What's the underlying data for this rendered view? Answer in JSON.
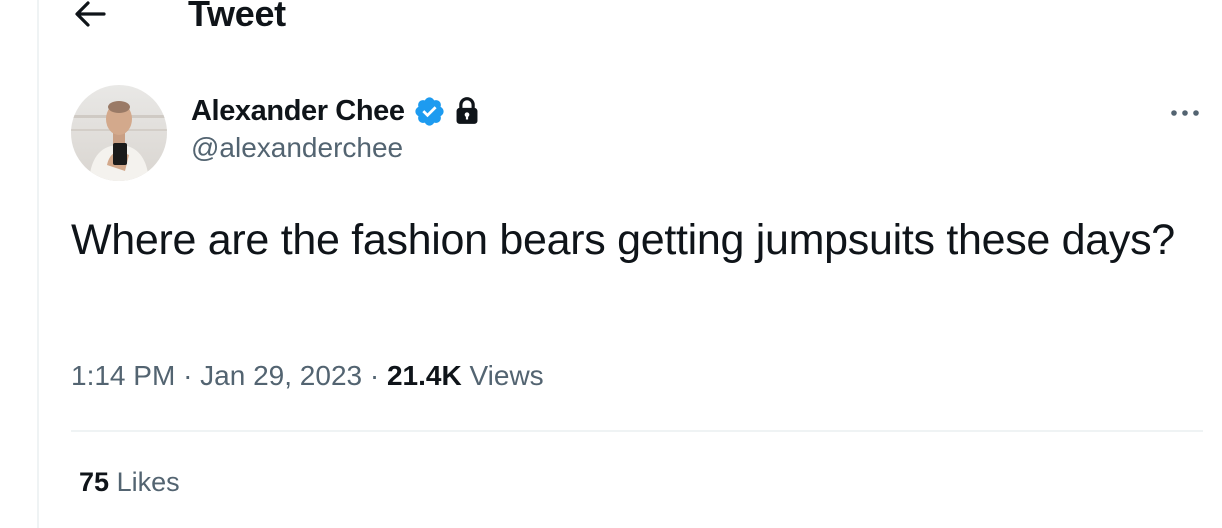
{
  "header": {
    "title": "Tweet",
    "back_icon": "arrow-left-icon"
  },
  "tweet": {
    "author": {
      "display_name": "Alexander Chee",
      "handle": "@alexanderchee",
      "verified": true,
      "protected": true,
      "avatar_icon": "user-avatar-photo"
    },
    "text": "Where are the fashion bears getting jumpsuits these days?",
    "time": "1:14 PM",
    "separator": "·",
    "date": "Jan 29, 2023",
    "views_count": "21.4K",
    "views_label": "Views",
    "likes_count": "75",
    "likes_label": "Likes"
  },
  "colors": {
    "text_primary": "#0f1419",
    "text_secondary": "#536471",
    "verified_blue": "#1d9bf0",
    "divider": "#eff3f4"
  }
}
